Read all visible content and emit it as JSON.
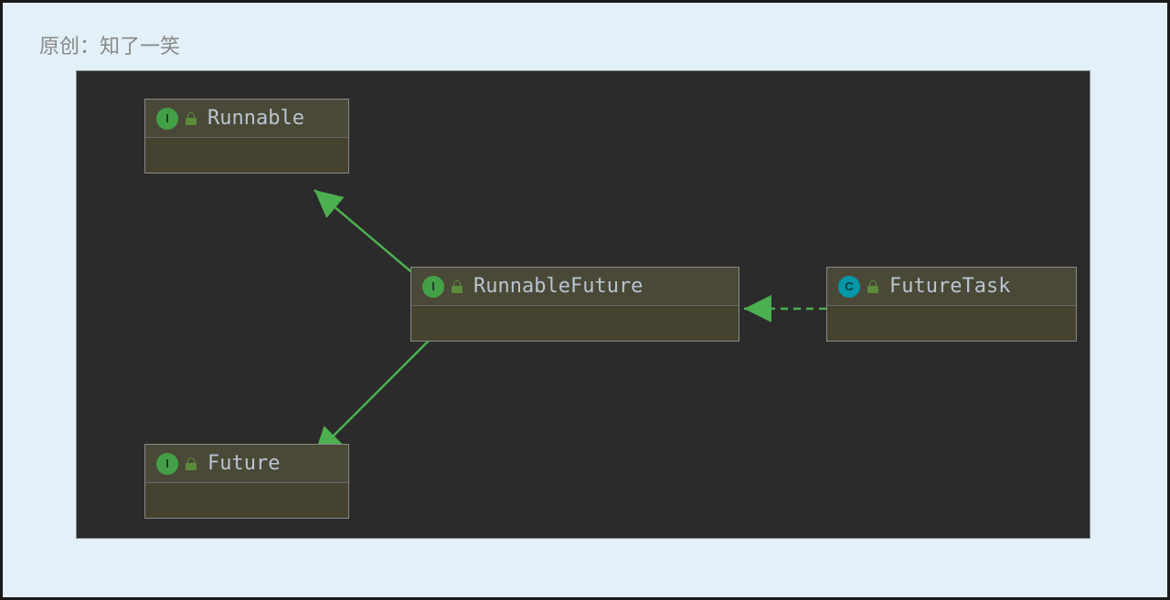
{
  "attribution": "原创：知了一笑",
  "nodes": {
    "runnable": {
      "type_letter": "I",
      "name": "Runnable"
    },
    "future": {
      "type_letter": "I",
      "name": "Future"
    },
    "runnablefuture": {
      "type_letter": "I",
      "name": "RunnableFuture"
    },
    "futuretask": {
      "type_letter": "C",
      "name": "FutureTask"
    }
  },
  "diagram": {
    "edges": [
      {
        "from": "RunnableFuture",
        "to": "Runnable",
        "style": "solid",
        "relation": "extends"
      },
      {
        "from": "RunnableFuture",
        "to": "Future",
        "style": "solid",
        "relation": "extends"
      },
      {
        "from": "FutureTask",
        "to": "RunnableFuture",
        "style": "dashed",
        "relation": "implements"
      }
    ]
  },
  "colors": {
    "background_outer": "#e3f0f8",
    "background_inner": "#2b2b2b",
    "box_fill": "#4a4837",
    "arrow": "#4caf50",
    "interface_badge": "#43a047",
    "class_badge": "#0097a7",
    "text": "#b8c4d0"
  }
}
